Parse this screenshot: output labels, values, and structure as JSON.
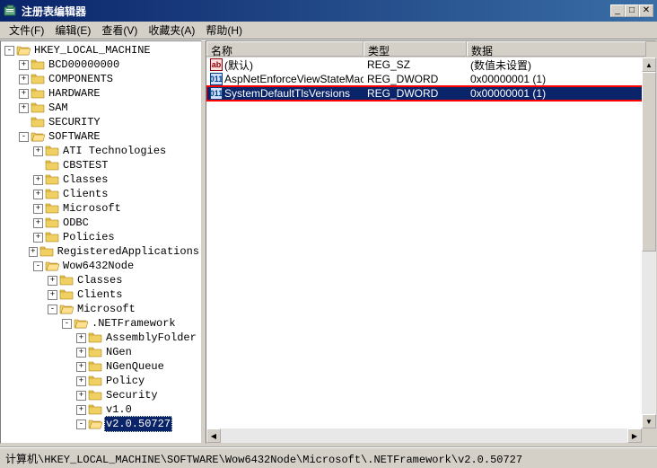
{
  "window": {
    "title": "注册表编辑器"
  },
  "menu": {
    "file": "文件(F)",
    "edit": "编辑(E)",
    "view": "查看(V)",
    "favorites": "收藏夹(A)",
    "help": "帮助(H)"
  },
  "tree": [
    {
      "depth": 0,
      "toggle": "-",
      "open": true,
      "label": "HKEY_LOCAL_MACHINE"
    },
    {
      "depth": 1,
      "toggle": "+",
      "open": false,
      "label": "BCD00000000"
    },
    {
      "depth": 1,
      "toggle": "+",
      "open": false,
      "label": "COMPONENTS"
    },
    {
      "depth": 1,
      "toggle": "+",
      "open": false,
      "label": "HARDWARE"
    },
    {
      "depth": 1,
      "toggle": "+",
      "open": false,
      "label": "SAM"
    },
    {
      "depth": 1,
      "toggle": "",
      "open": false,
      "label": "SECURITY"
    },
    {
      "depth": 1,
      "toggle": "-",
      "open": true,
      "label": "SOFTWARE"
    },
    {
      "depth": 2,
      "toggle": "+",
      "open": false,
      "label": "ATI Technologies"
    },
    {
      "depth": 2,
      "toggle": "",
      "open": false,
      "label": "CBSTEST"
    },
    {
      "depth": 2,
      "toggle": "+",
      "open": false,
      "label": "Classes"
    },
    {
      "depth": 2,
      "toggle": "+",
      "open": false,
      "label": "Clients"
    },
    {
      "depth": 2,
      "toggle": "+",
      "open": false,
      "label": "Microsoft"
    },
    {
      "depth": 2,
      "toggle": "+",
      "open": false,
      "label": "ODBC"
    },
    {
      "depth": 2,
      "toggle": "+",
      "open": false,
      "label": "Policies"
    },
    {
      "depth": 2,
      "toggle": "+",
      "open": false,
      "label": "RegisteredApplications"
    },
    {
      "depth": 2,
      "toggle": "-",
      "open": true,
      "label": "Wow6432Node"
    },
    {
      "depth": 3,
      "toggle": "+",
      "open": false,
      "label": "Classes"
    },
    {
      "depth": 3,
      "toggle": "+",
      "open": false,
      "label": "Clients"
    },
    {
      "depth": 3,
      "toggle": "-",
      "open": true,
      "label": "Microsoft"
    },
    {
      "depth": 4,
      "toggle": "-",
      "open": true,
      "label": ".NETFramework"
    },
    {
      "depth": 5,
      "toggle": "+",
      "open": false,
      "label": "AssemblyFolder"
    },
    {
      "depth": 5,
      "toggle": "+",
      "open": false,
      "label": "NGen"
    },
    {
      "depth": 5,
      "toggle": "+",
      "open": false,
      "label": "NGenQueue"
    },
    {
      "depth": 5,
      "toggle": "+",
      "open": false,
      "label": "Policy"
    },
    {
      "depth": 5,
      "toggle": "+",
      "open": false,
      "label": "Security"
    },
    {
      "depth": 5,
      "toggle": "+",
      "open": false,
      "label": "v1.0"
    },
    {
      "depth": 5,
      "toggle": "-",
      "open": true,
      "label": "v2.0.50727",
      "selected": true
    }
  ],
  "listHeader": {
    "name": "名称",
    "type": "类型",
    "data": "数据"
  },
  "listCols": {
    "c1": 175,
    "c2": 115,
    "c3": 200
  },
  "listRows": [
    {
      "icon": "ab",
      "name": "(默认)",
      "type": "REG_SZ",
      "data": "(数值未设置)",
      "selected": false,
      "highlight": false
    },
    {
      "icon": "bin",
      "name": "AspNetEnforceViewStateMac",
      "type": "REG_DWORD",
      "data": "0x00000001 (1)",
      "selected": false,
      "highlight": false
    },
    {
      "icon": "bin",
      "name": "SystemDefaultTlsVersions",
      "type": "REG_DWORD",
      "data": "0x00000001 (1)",
      "selected": true,
      "highlight": true
    }
  ],
  "iconText": {
    "ab": "ab",
    "bin": "011"
  },
  "statusbar": "计算机\\HKEY_LOCAL_MACHINE\\SOFTWARE\\Wow6432Node\\Microsoft\\.NETFramework\\v2.0.50727"
}
